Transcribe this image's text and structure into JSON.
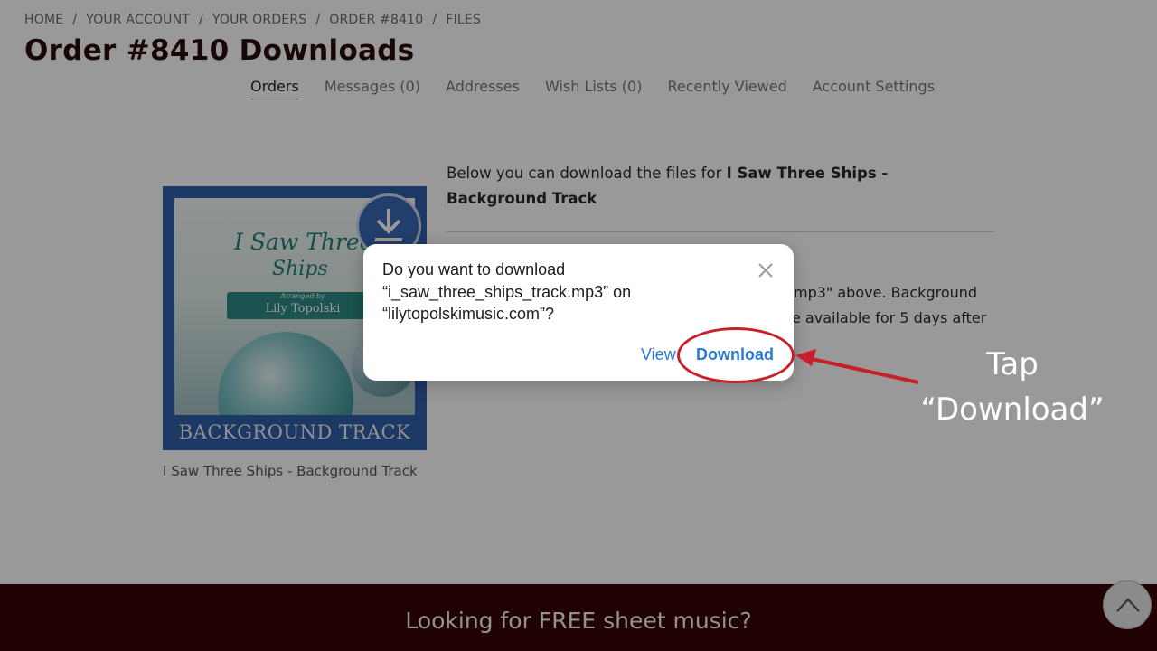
{
  "breadcrumb": [
    "HOME",
    "YOUR ACCOUNT",
    "YOUR ORDERS",
    "ORDER #8410",
    "FILES"
  ],
  "page_title": "Order #8410 Downloads",
  "account_nav": [
    {
      "label": "Orders",
      "active": true
    },
    {
      "label": "Messages (0)",
      "active": false
    },
    {
      "label": "Addresses",
      "active": false
    },
    {
      "label": "Wish Lists (0)",
      "active": false
    },
    {
      "label": "Recently Viewed",
      "active": false
    },
    {
      "label": "Account Settings",
      "active": false
    }
  ],
  "product": {
    "art": {
      "title_line1": "I Saw Three",
      "title_line2": "Ships",
      "arranged_by": "Arranged by",
      "arranger": "Lily Topolski",
      "banner_text": "BACKGROUND TRACK"
    },
    "caption": "I Saw Three Ships - Background Track"
  },
  "content": {
    "intro_prefix": "Below you can download the files for ",
    "intro_bold": "I Saw Three Ships - Background Track",
    "partial_line1": "mp3\" above. Background",
    "partial_line2": "e available for 5 days after"
  },
  "dialog": {
    "message": "Do you want to download “i_saw_three_ships_track.mp3” on “lilytopolskimusic.com”?",
    "view_label": "View",
    "download_label": "Download"
  },
  "annotation": {
    "line1": "Tap",
    "line2": "“Download”"
  },
  "footer": {
    "text": "Looking for FREE sheet music?"
  },
  "colors": {
    "title": "#2b0a0a",
    "footer_bg": "#3a0606",
    "link_blue": "#2b7bd3",
    "annotation_red": "#c8202a",
    "album_blue": "#2f5ea8"
  },
  "icons": [
    "download-badge-icon",
    "close-icon",
    "chevron-up-icon",
    "arrow-icon"
  ]
}
